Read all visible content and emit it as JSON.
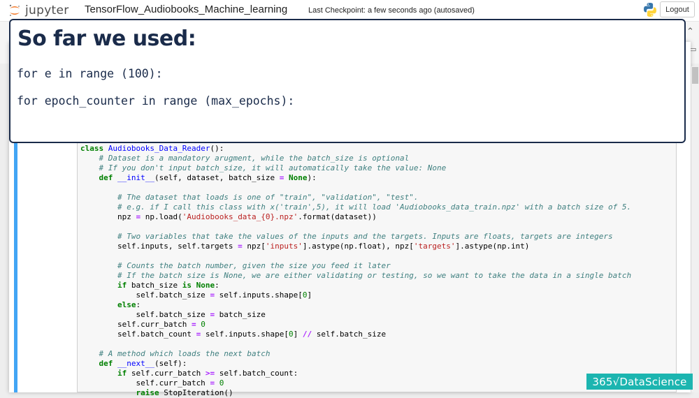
{
  "header": {
    "logo_text": "jupyter",
    "notebook_title": "TensorFlow_Audiobooks_Machine_learning",
    "checkpoint": "Last Checkpoint: a few seconds ago (autosaved)",
    "logout_label": "Logout",
    "kernel_icon": "python-logo-icon"
  },
  "overlay": {
    "title": "So far we used:",
    "lines": [
      "for e in range (100):",
      "for epoch_counter in range (max_epochs):"
    ]
  },
  "watermark": "365√DataScience",
  "colors": {
    "overlay_navy": "#1a2b4a",
    "cell_border_blue": "#42a5f5",
    "brand_teal": "#1cb5b0",
    "keyword_green": "#008000",
    "comment_teal": "#408080",
    "string_red": "#ba2121"
  },
  "code_lines": [
    "class Audiobooks_Data_Reader():",
    "    # Dataset is a mandatory arugment, while the batch_size is optional",
    "    # If you don't input batch_size, it will automatically take the value: None",
    "    def __init__(self, dataset, batch_size = None):",
    "",
    "        # The dataset that loads is one of \"train\", \"validation\", \"test\".",
    "        # e.g. if I call this class with x('train',5), it will load 'Audiobooks_data_train.npz' with a batch size of 5.",
    "        npz = np.load('Audiobooks_data_{0}.npz'.format(dataset))",
    "",
    "        # Two variables that take the values of the inputs and the targets. Inputs are floats, targets are integers",
    "        self.inputs, self.targets = npz['inputs'].astype(np.float), npz['targets'].astype(np.int)",
    "",
    "        # Counts the batch number, given the size you feed it later",
    "        # If the batch size is None, we are either validating or testing, so we want to take the data in a single batch",
    "        if batch_size is None:",
    "            self.batch_size = self.inputs.shape[0]",
    "        else:",
    "            self.batch_size = batch_size",
    "        self.curr_batch = 0",
    "        self.batch_count = self.inputs.shape[0] // self.batch_size",
    "",
    "    # A method which loads the next batch",
    "    def __next__(self):",
    "        if self.curr_batch >= self.batch_count:",
    "            self.curr_batch = 0",
    "            raise StopIteration()"
  ]
}
